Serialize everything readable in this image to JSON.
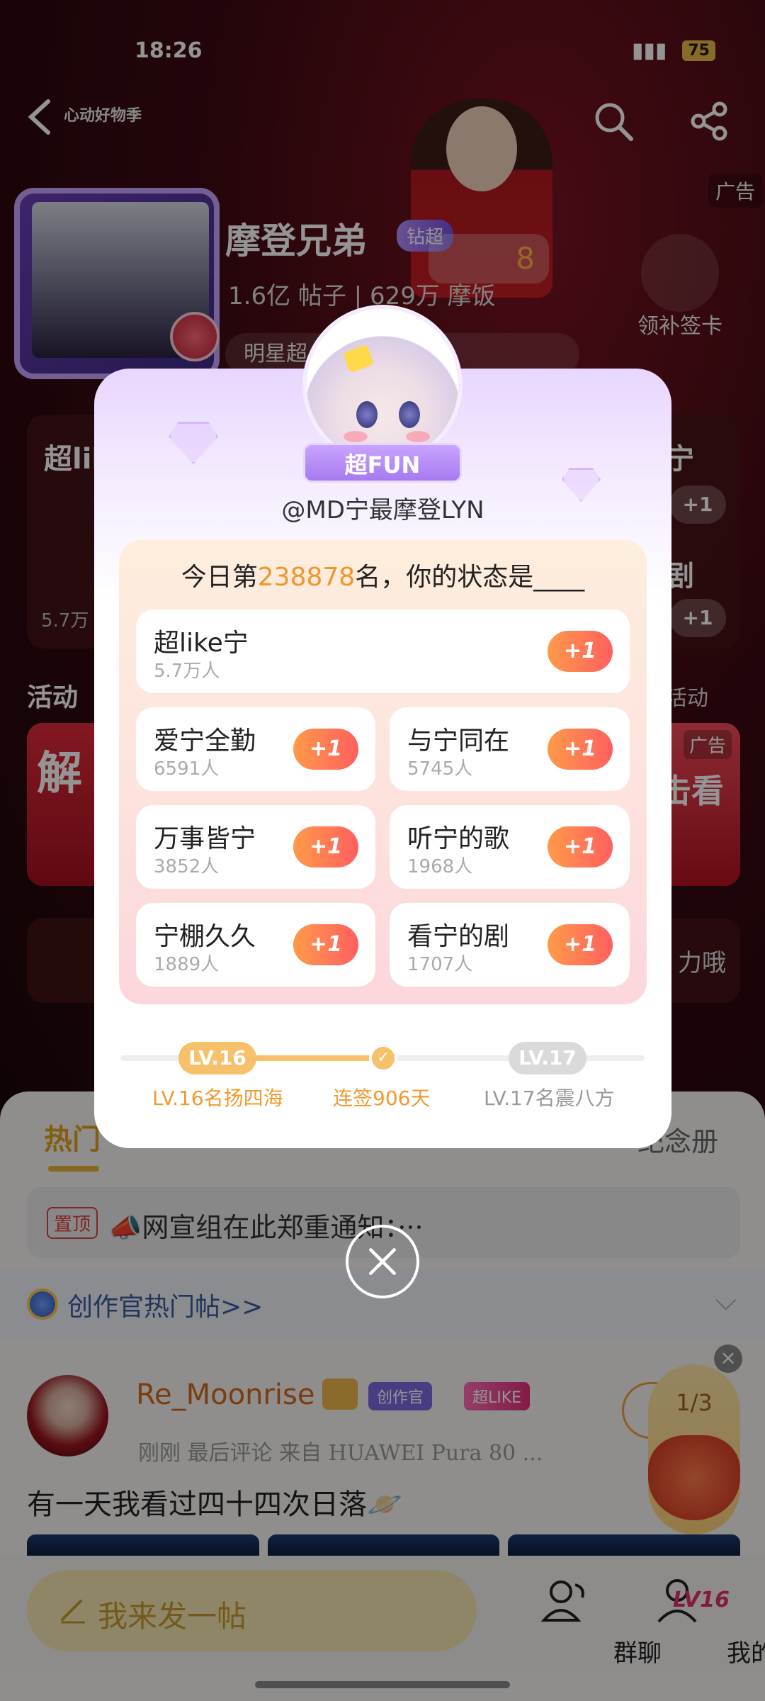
{
  "status_bar": {
    "time": "18:26",
    "battery": "75"
  },
  "header": {
    "ad_label": "广告",
    "event_logo": "心动好物季"
  },
  "supertopic": {
    "name": "摩登兄弟",
    "badge": "钻超",
    "stats": "1.6亿 帖子 | 629万 摩饭",
    "rank_chip": "8",
    "starline": "明星超",
    "checkin_label": "领补签卡"
  },
  "cards": {
    "left_title": "超lik",
    "left_sub": "5.7万",
    "right_r1": "宁",
    "right_r2": "剧",
    "right_plus": "+1"
  },
  "activity": {
    "title": "活动",
    "more": "活动",
    "left_text": "解",
    "right_text": "击看",
    "right_ad": "广告"
  },
  "post_strip": {
    "text": "力哦"
  },
  "modal": {
    "badge": "超FUN",
    "username": "@MD宁最摩登LYN",
    "rank_prefix": "今日第",
    "rank_number": "238878",
    "rank_suffix": "名，你的状态是____",
    "options": [
      {
        "name": "超like宁",
        "count": "5.7万人",
        "plus": "+1"
      },
      {
        "name": "爱宁全勤",
        "count": "6591人",
        "plus": "+1"
      },
      {
        "name": "与宁同在",
        "count": "5745人",
        "plus": "+1"
      },
      {
        "name": "万事皆宁",
        "count": "3852人",
        "plus": "+1"
      },
      {
        "name": "听宁的歌",
        "count": "1968人",
        "plus": "+1"
      },
      {
        "name": "宁棚久久",
        "count": "1889人",
        "plus": "+1"
      },
      {
        "name": "看宁的剧",
        "count": "1707人",
        "plus": "+1"
      }
    ],
    "level": {
      "current": "LV.16",
      "next": "LV.17",
      "current_label": "LV.16名扬四海",
      "streak_label": "连签906天",
      "next_label": "LV.17名震八方"
    }
  },
  "feed": {
    "tab_hot": "热门",
    "tab_album": "纪念册",
    "pinned_badge": "置顶",
    "pinned_text": "📣网宣组在此郑重通知：···",
    "creator_row": "创作官热门帖>>",
    "post": {
      "user": "Re_Moonrise",
      "badge_creator": "创作官",
      "badge_superlike": "超LIKE",
      "meta": "刚刚 最后评论  来自 HUAWEI Pura 80 ...",
      "body": "有一天我看过四十四次日落🪐"
    },
    "lucky_bag": {
      "count": "1/3"
    }
  },
  "bottom_nav": {
    "compose": "我来发一帖",
    "group_chat": "群聊",
    "mine": "我的",
    "level": "LV16"
  }
}
